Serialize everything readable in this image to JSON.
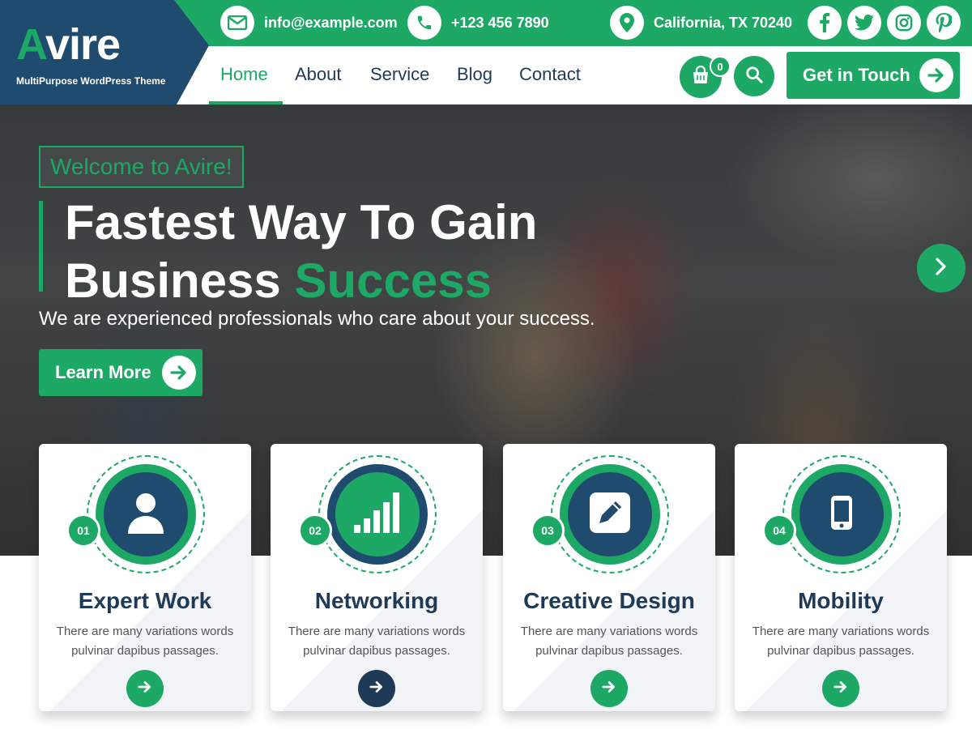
{
  "brand": {
    "logo_first": "A",
    "logo_rest": "vire",
    "tagline": "MultiPurpose WordPress Theme"
  },
  "topbar": {
    "email": "info@example.com",
    "phone": "+123 456 7890",
    "location": "California, TX 70240",
    "social": [
      "facebook-icon",
      "twitter-icon",
      "instagram-icon",
      "pinterest-icon"
    ]
  },
  "nav": {
    "items": [
      {
        "label": "Home",
        "active": true
      },
      {
        "label": "About",
        "active": false
      },
      {
        "label": "Service",
        "active": false
      },
      {
        "label": "Blog",
        "active": false
      },
      {
        "label": "Contact",
        "active": false
      }
    ],
    "cart_count": "0",
    "cta_label": "Get in Touch"
  },
  "hero": {
    "badge": "Welcome to Avire!",
    "title_line1": "Fastest Way To Gain",
    "title_line2_plain": "Business ",
    "title_line2_accent": "Success",
    "subtitle": "We are experienced professionals who care about your success.",
    "button_label": "Learn More"
  },
  "features": [
    {
      "number": "01",
      "title": "Expert Work",
      "desc_line1": "There are many variations words",
      "desc_line2": "pulvinar dapibus passages.",
      "icon": "user-icon"
    },
    {
      "number": "02",
      "title": "Networking",
      "desc_line1": "There are many variations words",
      "desc_line2": "pulvinar dapibus passages.",
      "icon": "signal-bars-icon"
    },
    {
      "number": "03",
      "title": "Creative Design",
      "desc_line1": "There are many variations words",
      "desc_line2": "pulvinar dapibus passages.",
      "icon": "pencil-icon"
    },
    {
      "number": "04",
      "title": "Mobility",
      "desc_line1": "There are many variations words",
      "desc_line2": "pulvinar dapibus passages.",
      "icon": "mobile-phone-icon"
    }
  ],
  "colors": {
    "accent": "#1ea866",
    "navy": "#1f4b6e",
    "heading": "#1f3a57"
  }
}
